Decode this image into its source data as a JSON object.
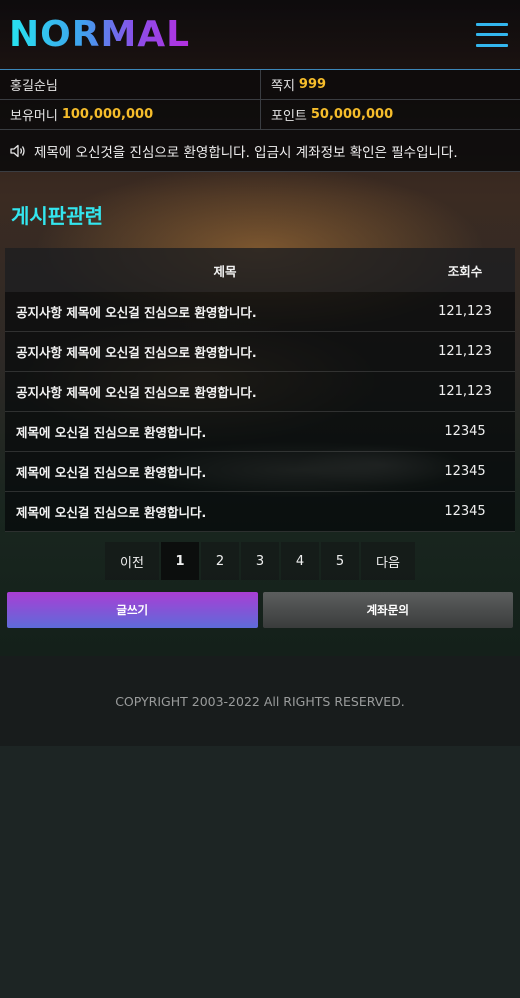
{
  "header": {
    "logo": "NORMAL"
  },
  "user": {
    "name": "홍길순님",
    "message_label": "쪽지",
    "message_count": "999",
    "money_label": "보유머니",
    "money_value": "100,000,000",
    "point_label": "포인트",
    "point_value": "50,000,000"
  },
  "notice": {
    "text": "제목에 오신것을 진심으로 환영합니다. 입금시 계좌정보 확인은 필수입니다."
  },
  "section": {
    "title": "게시판관련"
  },
  "board": {
    "columns": {
      "title": "제목",
      "views": "조회수"
    },
    "rows": [
      {
        "title": "공지사항 제목에 오신걸 진심으로 환영합니다.",
        "views": "121,123"
      },
      {
        "title": "공지사항 제목에 오신걸 진심으로 환영합니다.",
        "views": "121,123"
      },
      {
        "title": "공지사항 제목에 오신걸 진심으로 환영합니다.",
        "views": "121,123"
      },
      {
        "title": "제목에 오신걸 진심으로 환영합니다.",
        "views": "12345"
      },
      {
        "title": "제목에 오신걸 진심으로 환영합니다.",
        "views": "12345"
      },
      {
        "title": "제목에 오신걸 진심으로 환영합니다.",
        "views": "12345"
      }
    ]
  },
  "pagination": {
    "prev": "이전",
    "pages": [
      "1",
      "2",
      "3",
      "4",
      "5"
    ],
    "next": "다음",
    "current": "1"
  },
  "actions": {
    "write": "글쓰기",
    "account_inquiry": "계좌문의"
  },
  "footer": {
    "copyright": "COPYRIGHT 2003-2022 All RIGHTS RESERVED."
  },
  "colors": {
    "accent_cyan": "#33e6ef",
    "gold": "#f6bd2b",
    "menu": "#33b6ee"
  }
}
